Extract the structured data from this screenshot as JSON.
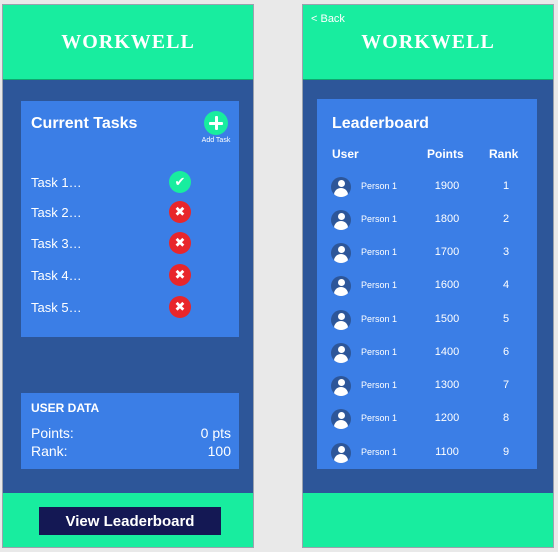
{
  "app_name": "WORKWELL",
  "home": {
    "tasks_card": {
      "title": "Current Tasks",
      "add_task_label": "Add Task",
      "tasks": [
        {
          "label": "Task 1…",
          "status": "done"
        },
        {
          "label": "Task 2…",
          "status": "pending"
        },
        {
          "label": "Task 3…",
          "status": "pending"
        },
        {
          "label": "Task 4…",
          "status": "pending"
        },
        {
          "label": "Task 5…",
          "status": "pending"
        }
      ]
    },
    "user_data": {
      "title": "USER DATA",
      "points_label": "Points:",
      "points_value": "0 pts",
      "rank_label": "Rank:",
      "rank_value": "100"
    },
    "view_leaderboard_label": "View Leaderboard"
  },
  "leaderboard": {
    "back_label": "< Back",
    "title": "Leaderboard",
    "columns": {
      "user": "User",
      "points": "Points",
      "rank": "Rank"
    },
    "rows": [
      {
        "user": "Person 1",
        "points": "1900",
        "rank": "1"
      },
      {
        "user": "Person 1",
        "points": "1800",
        "rank": "2"
      },
      {
        "user": "Person 1",
        "points": "1700",
        "rank": "3"
      },
      {
        "user": "Person 1",
        "points": "1600",
        "rank": "4"
      },
      {
        "user": "Person 1",
        "points": "1500",
        "rank": "5"
      },
      {
        "user": "Person 1",
        "points": "1400",
        "rank": "6"
      },
      {
        "user": "Person 1",
        "points": "1300",
        "rank": "7"
      },
      {
        "user": "Person 1",
        "points": "1200",
        "rank": "8"
      },
      {
        "user": "Person 1",
        "points": "1100",
        "rank": "9"
      }
    ]
  },
  "icons": {
    "add": "plus-icon",
    "done": "checkmark-icon",
    "pending": "x-icon",
    "avatar": "user-avatar-icon"
  },
  "colors": {
    "header": "#18ed9f",
    "background": "#2d5699",
    "card": "#3b7ee6",
    "button": "#141854",
    "done": "#18ed9f",
    "pending": "#e8262b"
  }
}
